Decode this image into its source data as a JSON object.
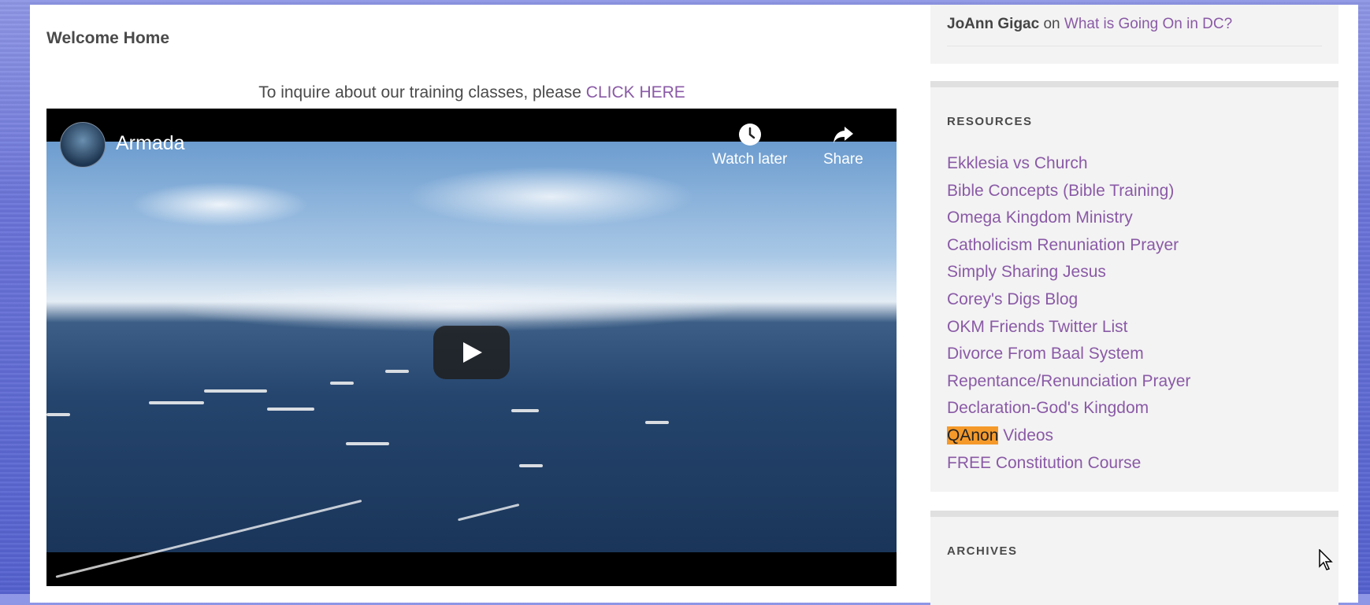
{
  "main": {
    "post_title": "Welcome Home",
    "inquire_text": "To inquire about our training classes, please",
    "inquire_link": "CLICK HERE"
  },
  "video": {
    "title": "Armada",
    "watch_later_label": "Watch later",
    "share_label": "Share"
  },
  "sidebar": {
    "recent_comment": {
      "author": "JoAnn Gigac",
      "on": "on",
      "post": "What is Going On in DC?"
    },
    "resources": {
      "heading": "RESOURCES",
      "items": [
        "Ekklesia vs Church",
        "Bible Concepts (Bible Training)",
        "Omega Kingdom Ministry",
        "Catholicism Renuniation Prayer",
        "Simply Sharing Jesus",
        "Corey's Digs Blog",
        "OKM Friends Twitter List",
        "Divorce From Baal System",
        "Repentance/Renunciation Prayer",
        "Declaration-God's Kingdom",
        "QAnon Videos",
        "FREE Constitution Course"
      ],
      "qanon_highlight": "QAnon",
      "qanon_rest": " Videos"
    },
    "archives": {
      "heading": "ARCHIVES"
    }
  },
  "colors": {
    "link": "#8a5aa6",
    "highlight": "#f59a2a",
    "widget_bg": "#f3f3f3"
  }
}
